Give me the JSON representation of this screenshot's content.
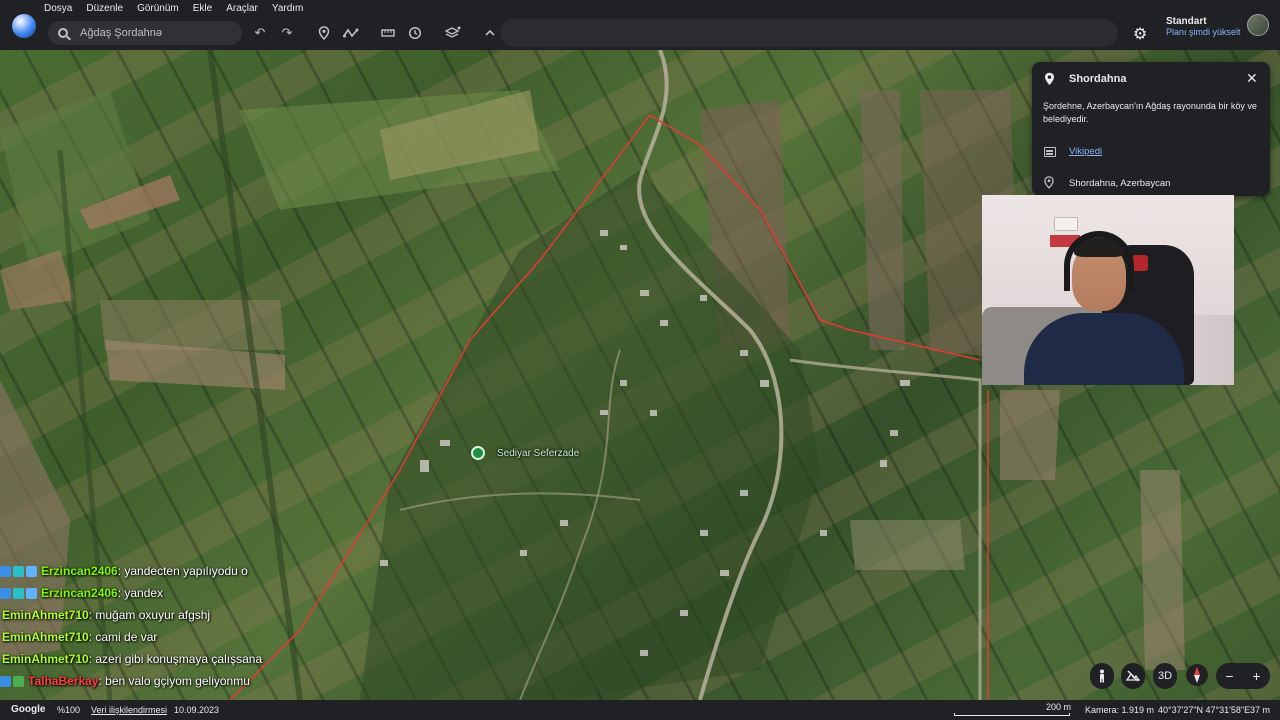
{
  "menu": [
    "Dosya",
    "Düzenle",
    "Görünüm",
    "Ekle",
    "Araçlar",
    "Yardım"
  ],
  "search": {
    "placeholder": "Ağdaş Şordahnə"
  },
  "toolbar_icons": [
    "undo-icon",
    "redo-icon",
    "placemark-icon",
    "path-icon",
    "ruler-icon",
    "history-icon",
    "layers-icon",
    "chevron-up-icon"
  ],
  "account": {
    "plan": "Standart",
    "upgrade": "Planı şimdi yükselt"
  },
  "panel": {
    "title": "Shordahna",
    "description": "Şordehne, Azerbaycan'ın Ağdaş rayonunda bir köy ve belediyedir.",
    "wiki_link": "Vikipedi",
    "address": "Shordahna, Azerbaycan"
  },
  "poi": {
    "label": "Sediyar Seferzade"
  },
  "chat": [
    {
      "user": "Erzincan2406",
      "message": ": yandecten yapılıyodu o",
      "color": "#7CFC00"
    },
    {
      "user": "Erzincan2406",
      "message": ": yandex",
      "color": "#7CFC00"
    },
    {
      "user": "EminAhmet710",
      "message": ": muğam oxuyur afgshj",
      "color": "#ADFF2F"
    },
    {
      "user": "EminAhmet710",
      "message": ": cami de var",
      "color": "#ADFF2F"
    },
    {
      "user": "EminAhmet710",
      "message": ": azeri gibi konuşmaya çalışsana",
      "color": "#ADFF2F"
    },
    {
      "user": "TalhaBerkay",
      "message": ": ben valo gçiyom geliyonmu",
      "color": "#FF3B3B"
    }
  ],
  "controls": {
    "three_d": "3D",
    "zoom_out": "−",
    "zoom_in": "+"
  },
  "status": {
    "brand": "Google",
    "zoom": "%100",
    "data_attribution": "Veri ilişkilendirmesi",
    "date": "10.09.2023",
    "scale": "200 m",
    "camera": "Kamera: 1.919 m",
    "coords": "40°37'27\"N 47°31'58\"E",
    "elevation": "37 m"
  },
  "colors": {
    "boundary": "#e53935",
    "accent": "#8ab4f8",
    "toolbar_bg": "#202124"
  }
}
